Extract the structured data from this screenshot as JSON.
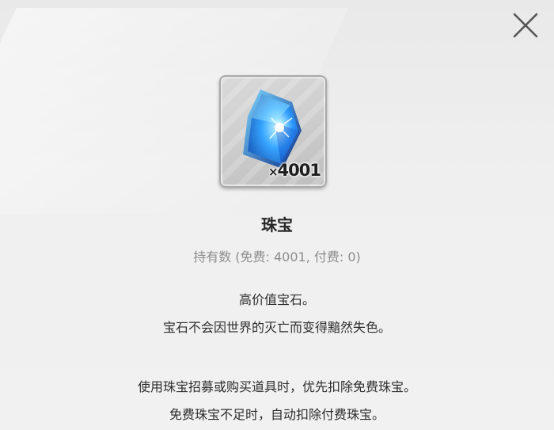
{
  "item": {
    "name": "珠宝",
    "quantity_prefix": "×",
    "quantity": "4001",
    "icon": "blue-gem-icon",
    "held_label": "持有数 (免费: 4001, 付费: 0)"
  },
  "description": {
    "line1": "高价值宝石。",
    "line2": "宝石不会因世界的灭亡而变得黯然失色。",
    "line3": "使用珠宝招募或购买道具时，优先扣除免费珠宝。",
    "line4": "免费珠宝不足时，自动扣除付费珠宝。"
  },
  "controls": {
    "close_icon": "close-icon"
  },
  "colors": {
    "gem_light": "#9ee8ff",
    "gem_mid": "#2f9cff",
    "gem_dark": "#0b3fa8",
    "text_muted": "#8d8d8d"
  }
}
